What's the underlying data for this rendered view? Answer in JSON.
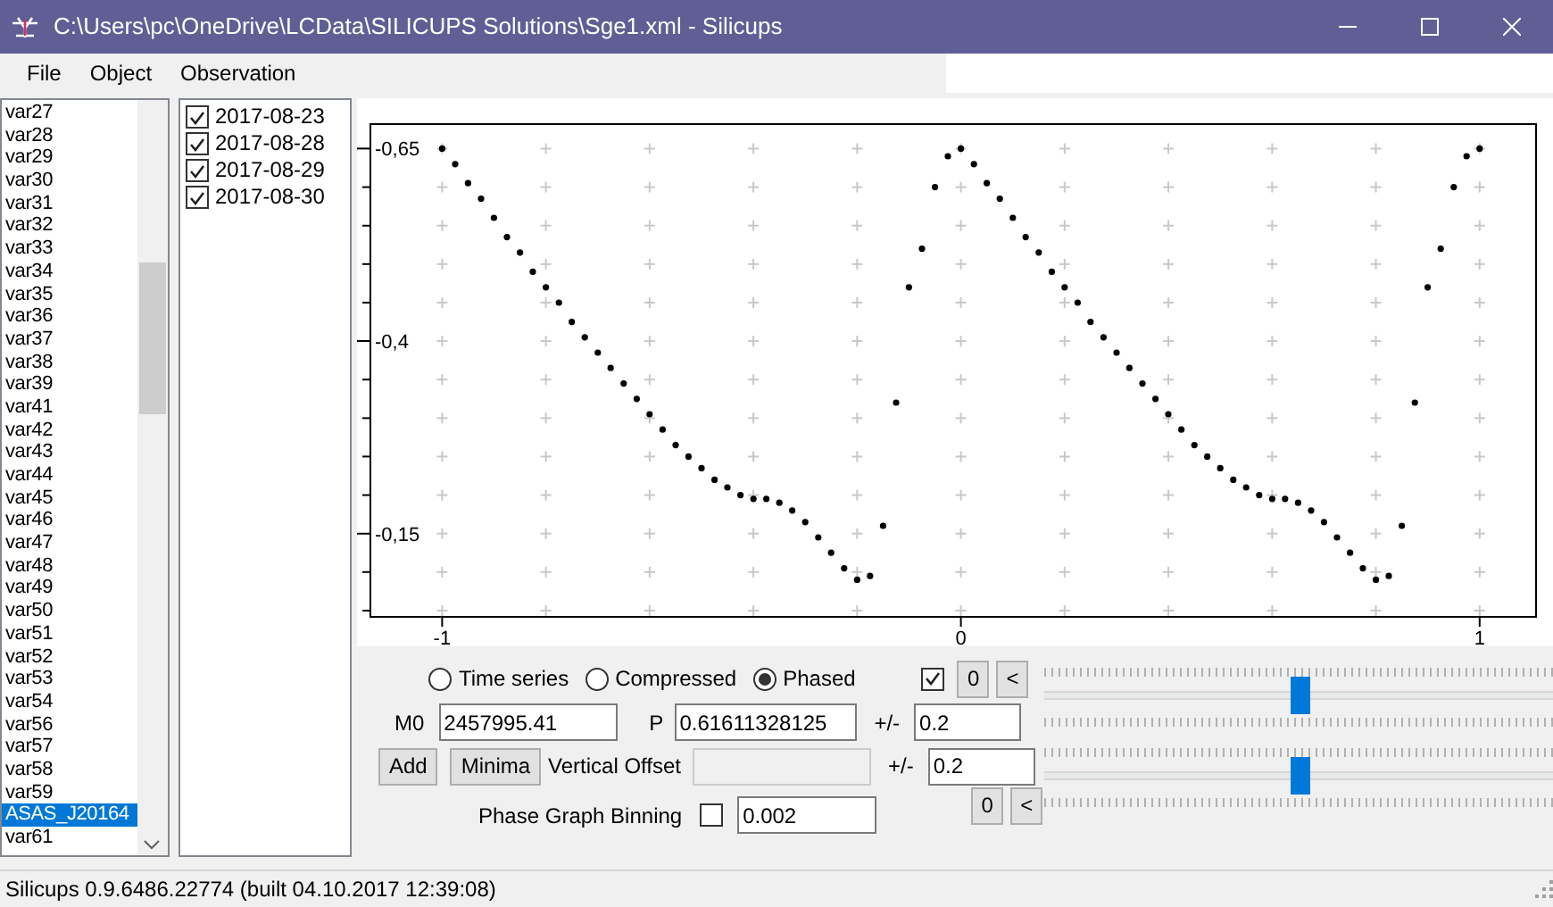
{
  "window": {
    "title": "C:\\Users\\pc\\OneDrive\\LCData\\SILICUPS Solutions\\Sge1.xml - Silicups"
  },
  "menu": [
    "File",
    "Object",
    "Observation"
  ],
  "objects": [
    {
      "label": "var27",
      "selected": false
    },
    {
      "label": "var28",
      "selected": false
    },
    {
      "label": "var29",
      "selected": false
    },
    {
      "label": "var30",
      "selected": false
    },
    {
      "label": "var31",
      "selected": false
    },
    {
      "label": "var32",
      "selected": false
    },
    {
      "label": "var33",
      "selected": false
    },
    {
      "label": "var34",
      "selected": false
    },
    {
      "label": "var35",
      "selected": false
    },
    {
      "label": "var36",
      "selected": false
    },
    {
      "label": "var37",
      "selected": false
    },
    {
      "label": "var38",
      "selected": false
    },
    {
      "label": "var39",
      "selected": false
    },
    {
      "label": "var41",
      "selected": false
    },
    {
      "label": "var42",
      "selected": false
    },
    {
      "label": "var43",
      "selected": false
    },
    {
      "label": "var44",
      "selected": false
    },
    {
      "label": "var45",
      "selected": false
    },
    {
      "label": "var46",
      "selected": false
    },
    {
      "label": "var47",
      "selected": false
    },
    {
      "label": "var48",
      "selected": false
    },
    {
      "label": "var49",
      "selected": false
    },
    {
      "label": "var50",
      "selected": false
    },
    {
      "label": "var51",
      "selected": false
    },
    {
      "label": "var52",
      "selected": false
    },
    {
      "label": "var53",
      "selected": false
    },
    {
      "label": "var54",
      "selected": false
    },
    {
      "label": "var56",
      "selected": false
    },
    {
      "label": "var57",
      "selected": false
    },
    {
      "label": "var58",
      "selected": false
    },
    {
      "label": "var59",
      "selected": false
    },
    {
      "label": "ASAS_J20164",
      "selected": true
    },
    {
      "label": "var61",
      "selected": false
    }
  ],
  "observations": [
    {
      "label": "2017-08-23",
      "checked": true
    },
    {
      "label": "2017-08-28",
      "checked": true
    },
    {
      "label": "2017-08-29",
      "checked": true
    },
    {
      "label": "2017-08-30",
      "checked": true
    }
  ],
  "chart": {
    "chart_data": {
      "type": "scatter",
      "xlim": [
        -1.14,
        1.107
      ],
      "ylim": [
        -0.043,
        -0.683
      ],
      "xticks": [
        -1,
        0,
        1
      ],
      "yticks": [
        {
          "value": -0.65,
          "label": "-0,65"
        },
        {
          "value": -0.4,
          "label": "-0,4"
        },
        {
          "value": -0.15,
          "label": "-0,15"
        }
      ],
      "x": [
        -1,
        -0.975,
        -0.95,
        -0.925,
        -0.9,
        -0.875,
        -0.85,
        -0.825,
        -0.8,
        -0.775,
        -0.75,
        -0.725,
        -0.7,
        -0.675,
        -0.65,
        -0.625,
        -0.6,
        -0.575,
        -0.55,
        -0.525,
        -0.5,
        -0.475,
        -0.45,
        -0.425,
        -0.4,
        -0.375,
        -0.35,
        -0.325,
        -0.3,
        -0.275,
        -0.25,
        -0.225,
        -0.2,
        -0.175,
        -0.15,
        -0.125,
        -0.1,
        -0.075,
        -0.05,
        -0.025,
        0,
        0.025,
        0.05,
        0.075,
        0.1,
        0.125,
        0.15,
        0.175,
        0.2,
        0.225,
        0.25,
        0.275,
        0.3,
        0.325,
        0.35,
        0.375,
        0.4,
        0.425,
        0.45,
        0.475,
        0.5,
        0.525,
        0.55,
        0.575,
        0.6,
        0.625,
        0.65,
        0.675,
        0.7,
        0.725,
        0.75,
        0.775,
        0.8,
        0.825,
        0.85,
        0.875,
        0.9,
        0.925,
        0.95,
        0.975,
        1
      ],
      "series": [
        {
          "color": "#000000",
          "values": [
            -0.65,
            -0.63,
            -0.605,
            -0.585,
            -0.56,
            -0.535,
            -0.515,
            -0.49,
            -0.47,
            -0.45,
            -0.425,
            -0.405,
            -0.385,
            -0.365,
            -0.345,
            -0.325,
            -0.305,
            -0.285,
            -0.265,
            -0.25,
            -0.235,
            -0.22,
            -0.21,
            -0.2,
            -0.195,
            -0.195,
            -0.19,
            -0.18,
            -0.165,
            -0.145,
            -0.125,
            -0.105,
            -0.09,
            -0.095,
            -0.16,
            -0.32,
            -0.47,
            -0.52,
            -0.6,
            -0.64,
            -0.65,
            -0.63,
            -0.605,
            -0.585,
            -0.56,
            -0.535,
            -0.515,
            -0.49,
            -0.47,
            -0.45,
            -0.425,
            -0.405,
            -0.385,
            -0.365,
            -0.345,
            -0.325,
            -0.305,
            -0.285,
            -0.265,
            -0.25,
            -0.235,
            -0.22,
            -0.21,
            -0.2,
            -0.195,
            -0.195,
            -0.19,
            -0.18,
            -0.165,
            -0.145,
            -0.125,
            -0.105,
            -0.09,
            -0.095,
            -0.16,
            -0.32,
            -0.47,
            -0.52,
            -0.6,
            -0.64,
            -0.65
          ]
        }
      ]
    }
  },
  "view_mode": [
    {
      "label": "Time series",
      "selected": false
    },
    {
      "label": "Compressed",
      "selected": false
    },
    {
      "label": "Phased",
      "selected": true
    }
  ],
  "top_tools": {
    "checked": true,
    "buttons": [
      "0",
      "<"
    ]
  },
  "m0": {
    "label": "M0",
    "value": "2457995.41"
  },
  "period": {
    "label": "P",
    "value": "0.61611328125",
    "tolerance_label": "+/-",
    "tolerance": "0.2"
  },
  "actions": [
    "Add",
    "Minima"
  ],
  "vertical_offset": {
    "label": "Vertical Offset",
    "disabled": true,
    "tolerance_label": "+/-",
    "tolerance": "0.2"
  },
  "binning": {
    "label": "Phase Graph Binning",
    "checked": false,
    "value": "0.002"
  },
  "bottom_tools": {
    "buttons": [
      "0",
      "<"
    ]
  },
  "sliders": [
    {
      "level": 0.5
    },
    {
      "level": 0.5
    }
  ],
  "status_bar": "Silicups 0.9.6486.22774 (built 04.10.2017 12:39:08)"
}
